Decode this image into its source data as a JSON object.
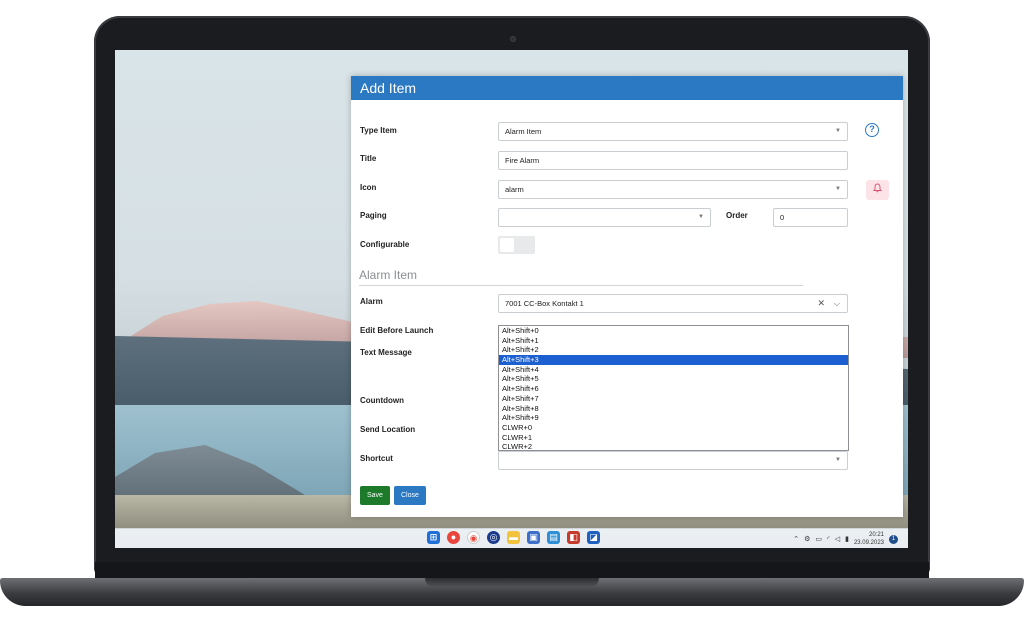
{
  "dialog": {
    "title": "Add Item",
    "labels": {
      "type_item": "Type Item",
      "title": "Title",
      "icon": "Icon",
      "paging": "Paging",
      "order": "Order",
      "configurable": "Configurable",
      "alarm": "Alarm",
      "edit_before_launch": "Edit Before Launch",
      "text_message": "Text Message",
      "countdown": "Countdown",
      "send_location": "Send Location",
      "shortcut": "Shortcut"
    },
    "values": {
      "type_item": "Alarm Item",
      "title": "Fire Alarm",
      "icon": "alarm",
      "paging": "",
      "order": "0",
      "alarm": "7001 CC-Box Kontakt 1",
      "shortcut": ""
    },
    "configurable_on": false,
    "section_title": "Alarm Item",
    "shortcut_options": [
      "Alt+Shift+0",
      "Alt+Shift+1",
      "Alt+Shift+2",
      "Alt+Shift+3",
      "Alt+Shift+4",
      "Alt+Shift+5",
      "Alt+Shift+6",
      "Alt+Shift+7",
      "Alt+Shift+8",
      "Alt+Shift+9",
      "CLWR+0",
      "CLWR+1",
      "CLWR+2"
    ],
    "shortcut_highlighted": "Alt+Shift+3",
    "buttons": {
      "save": "Save",
      "close": "Close"
    },
    "icons": {
      "help": "help-circle-icon",
      "bell": "bell-icon",
      "clear": "clear-x-icon",
      "chevron": "chevron-down-icon"
    },
    "colors": {
      "header": "#2b79c2",
      "save": "#1d7a2a",
      "close": "#2b79c2",
      "bell_bg": "#fbe3e8",
      "highlight": "#1c5fd1"
    }
  },
  "taskbar": {
    "time": "20:21",
    "date": "23.09.2023",
    "notification_count": "1"
  }
}
